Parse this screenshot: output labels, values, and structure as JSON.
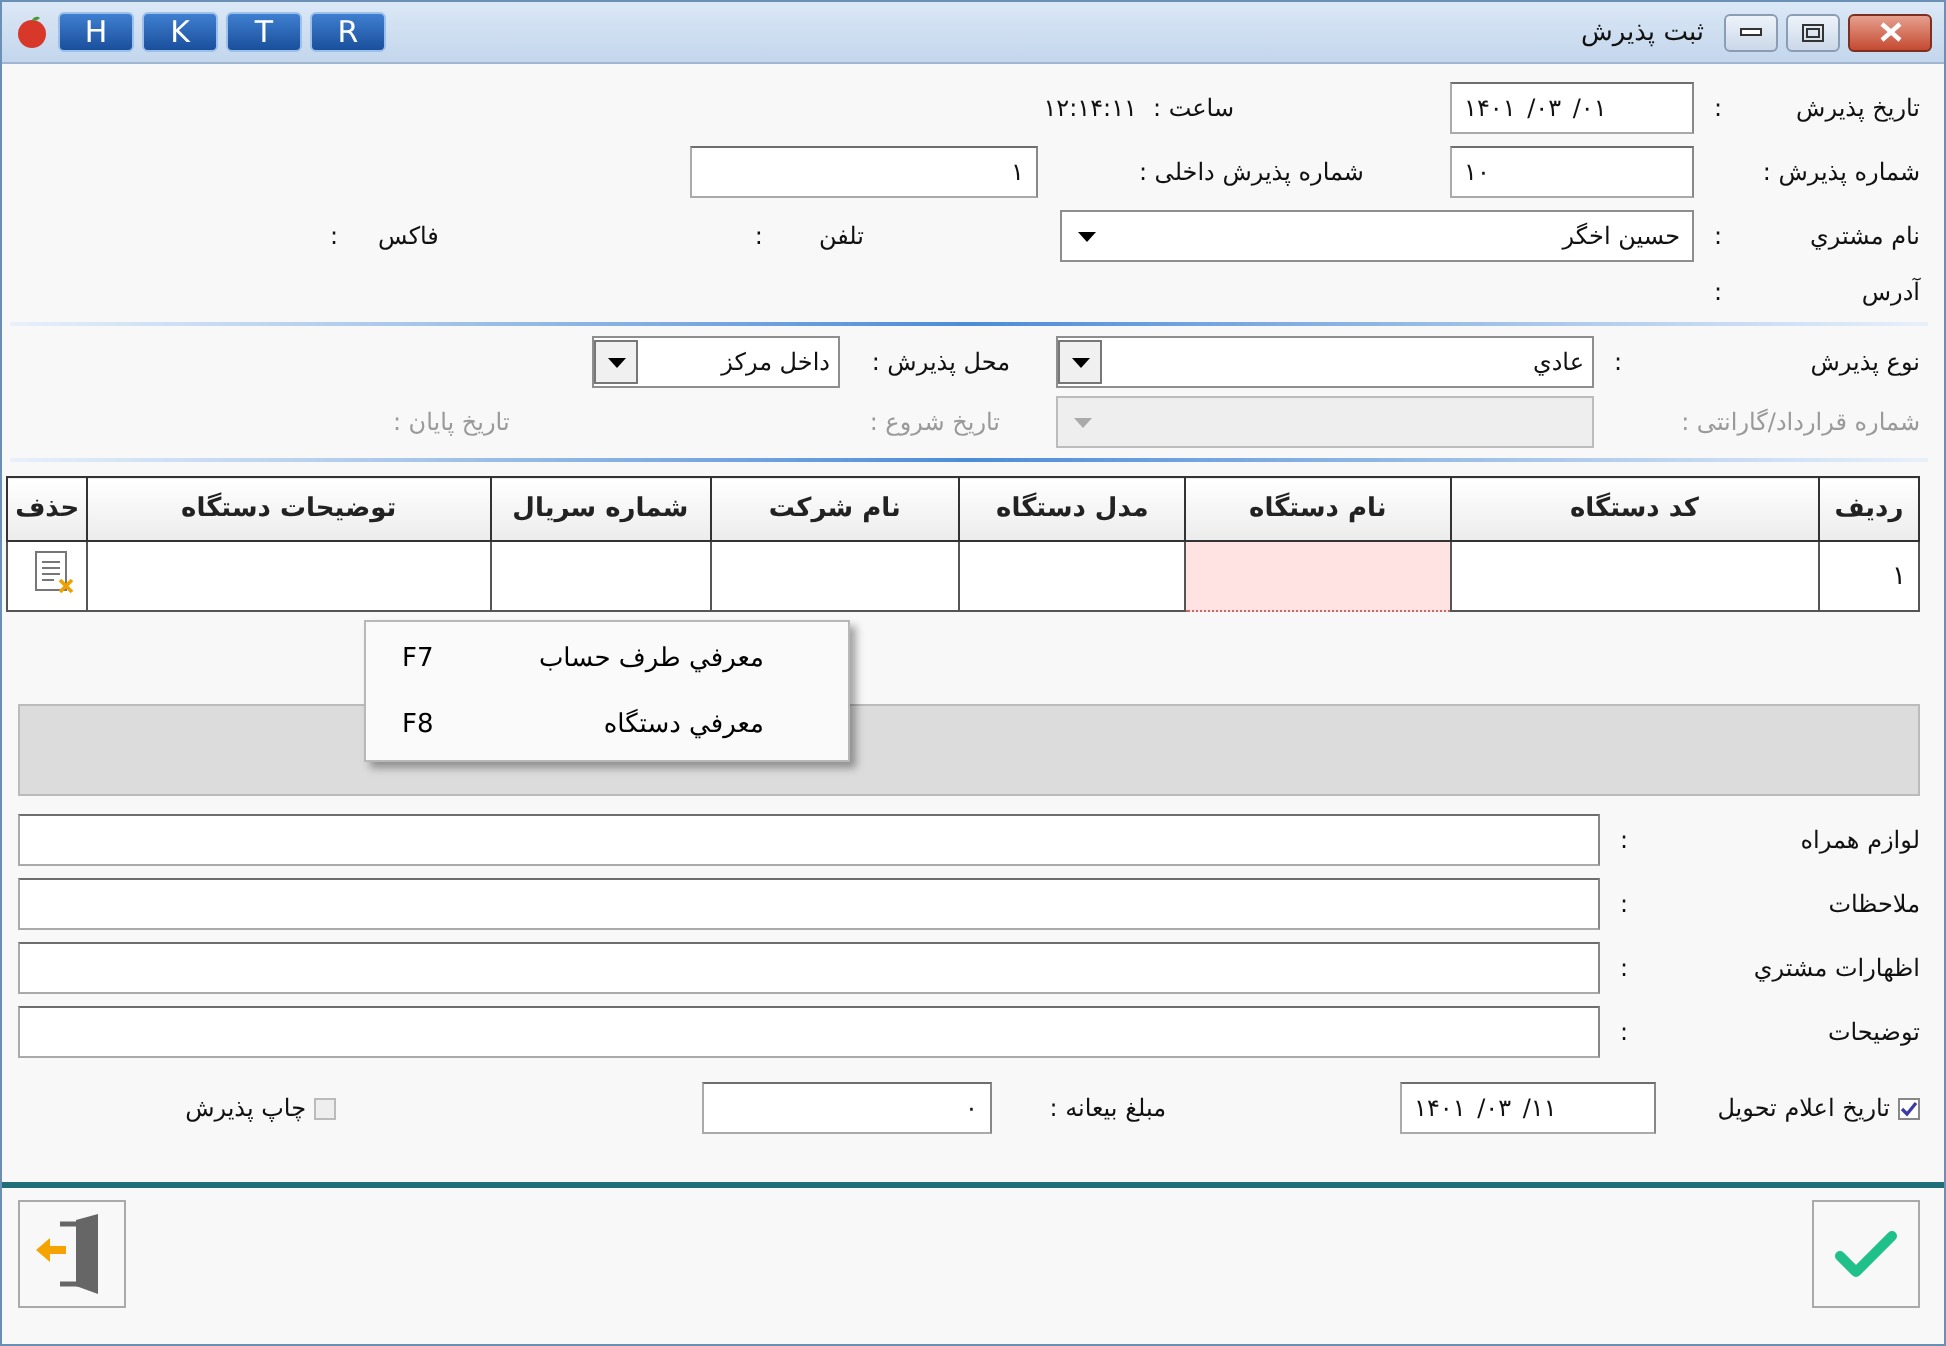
{
  "window": {
    "title": "ثبت پذیرش",
    "shortcut_buttons": [
      "R",
      "T",
      "K",
      "H"
    ]
  },
  "reception": {
    "date": {
      "label": "تاریخ  پذیرش",
      "colon": ":",
      "value": "۱۴۰۱   /۰۳   /۰۱"
    },
    "time": {
      "label": "ساعت :",
      "value": "۱۲:۱۴:۱۱"
    },
    "number": {
      "label": "شماره پذیرش :",
      "value": "۱۰"
    },
    "internal_number": {
      "label": "شماره پذیرش داخلی :",
      "value": "۱"
    },
    "customer": {
      "label": "نام مشتري",
      "colon": ":",
      "value": "حسین اخگر"
    },
    "phone": {
      "label": "تلفن",
      "colon": ":"
    },
    "fax": {
      "label": "فاکس",
      "colon": ":"
    },
    "address": {
      "label": "آدرس",
      "colon": ":"
    }
  },
  "details": {
    "type": {
      "label": "نوع پذیرش",
      "colon": ":",
      "value": "عادي"
    },
    "location": {
      "label": "محل پذیرش :",
      "value": "داخل مرکز"
    },
    "contract": {
      "label": "شماره قرارداد/گارانتی :",
      "disabled": true
    },
    "start_date": {
      "label": "تاریخ شروع :",
      "disabled": true
    },
    "end_date": {
      "label": "تاریخ پایان :",
      "disabled": true
    }
  },
  "table": {
    "columns": [
      "ردیف",
      "کد دستگاه",
      "نام دستگاه",
      "مدل دستگاه",
      "نام شرکت",
      "شماره سریال",
      "توضیحات دستگاه",
      "حذف"
    ],
    "rows": [
      {
        "cells": [
          {
            "text": "۱",
            "selected": false
          },
          {
            "selected": false
          },
          {
            "selected": true
          },
          {
            "selected": false
          },
          {
            "selected": false
          },
          {
            "selected": false
          },
          {
            "selected": false
          }
        ]
      }
    ]
  },
  "context_menu": {
    "items": [
      {
        "label": "معرفي طرف حساب",
        "shortcut": "F7"
      },
      {
        "label": "معرفي دستگاه",
        "shortcut": "F8"
      }
    ]
  },
  "notes": [
    {
      "label": "لوازم همراه",
      "colon": ":"
    },
    {
      "label": "ملاحظات",
      "colon": ":"
    },
    {
      "label": "اظهارات مشتري",
      "colon": ":"
    },
    {
      "label": "توضیحات",
      "colon": ":"
    }
  ],
  "delivery": {
    "label": "تاریخ اعلام تحویل",
    "checked": true,
    "value": "۱۴۰۱   /۰۳   /۱۱"
  },
  "deposit": {
    "label": "مبلغ بیعانه :",
    "value": "۰"
  },
  "print": {
    "label": "چاپ پذیرش",
    "checked": false,
    "disabled": true
  }
}
